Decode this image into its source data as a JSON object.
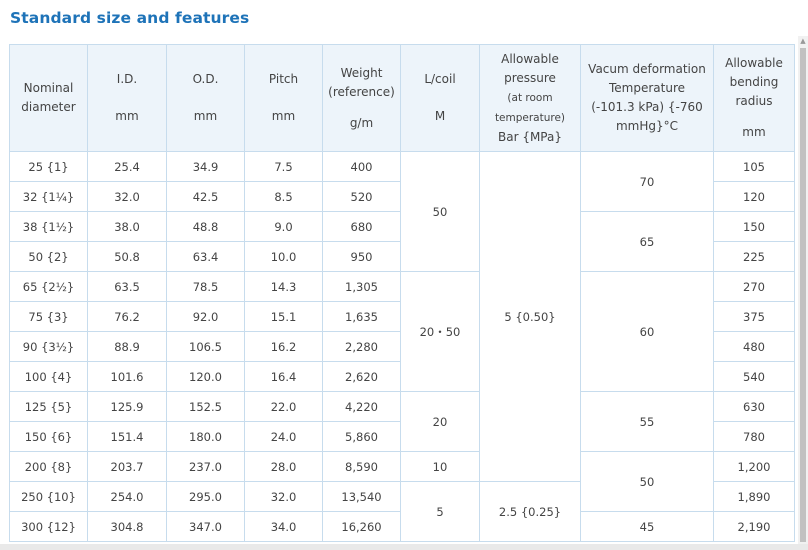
{
  "title": "Standard size and features",
  "headers": {
    "nominal": [
      "Nominal",
      "diameter"
    ],
    "id": {
      "label": "I.D.",
      "unit": "mm"
    },
    "od": {
      "label": "O.D.",
      "unit": "mm"
    },
    "pitch": {
      "label": "Pitch",
      "unit": "mm"
    },
    "weight": {
      "label1": "Weight",
      "label2": "(reference)",
      "unit": "g/m"
    },
    "coil": {
      "label": "L/coil",
      "unit": "M"
    },
    "pressure": {
      "l1": "Allowable",
      "l2": "pressure",
      "l3": "(at room",
      "l4": "temperature)",
      "l5": "Bar {MPa}"
    },
    "vacuum": {
      "l1": "Vacum deformation",
      "l2": "Temperature",
      "l3": "(-101.3 kPa) {-760",
      "l4": "mmHg}°C"
    },
    "bending": {
      "l1": "Allowable",
      "l2": "bending",
      "l3": "radius",
      "unit": "mm"
    }
  },
  "rows": [
    {
      "nominal": "25 {1}",
      "id": "25.4",
      "od": "34.9",
      "pitch": "7.5",
      "weight": "400",
      "radius": "105"
    },
    {
      "nominal": "32 {1¼}",
      "id": "32.0",
      "od": "42.5",
      "pitch": "8.5",
      "weight": "520",
      "radius": "120"
    },
    {
      "nominal": "38 {1½}",
      "id": "38.0",
      "od": "48.8",
      "pitch": "9.0",
      "weight": "680",
      "radius": "150"
    },
    {
      "nominal": "50 {2}",
      "id": "50.8",
      "od": "63.4",
      "pitch": "10.0",
      "weight": "950",
      "radius": "225"
    },
    {
      "nominal": "65 {2½}",
      "id": "63.5",
      "od": "78.5",
      "pitch": "14.3",
      "weight": "1,305",
      "radius": "270"
    },
    {
      "nominal": "75 {3}",
      "id": "76.2",
      "od": "92.0",
      "pitch": "15.1",
      "weight": "1,635",
      "radius": "375"
    },
    {
      "nominal": "90 {3½}",
      "id": "88.9",
      "od": "106.5",
      "pitch": "16.2",
      "weight": "2,280",
      "radius": "480"
    },
    {
      "nominal": "100 {4}",
      "id": "101.6",
      "od": "120.0",
      "pitch": "16.4",
      "weight": "2,620",
      "radius": "540"
    },
    {
      "nominal": "125 {5}",
      "id": "125.9",
      "od": "152.5",
      "pitch": "22.0",
      "weight": "4,220",
      "radius": "630"
    },
    {
      "nominal": "150 {6}",
      "id": "151.4",
      "od": "180.0",
      "pitch": "24.0",
      "weight": "5,860",
      "radius": "780"
    },
    {
      "nominal": "200 {8}",
      "id": "203.7",
      "od": "237.0",
      "pitch": "28.0",
      "weight": "8,590",
      "radius": "1,200"
    },
    {
      "nominal": "250 {10}",
      "id": "254.0",
      "od": "295.0",
      "pitch": "32.0",
      "weight": "13,540",
      "radius": "1,890"
    },
    {
      "nominal": "300 {12}",
      "id": "304.8",
      "od": "347.0",
      "pitch": "34.0",
      "weight": "16,260",
      "radius": "2,190"
    }
  ],
  "coil_groups": [
    "50",
    "20・50",
    "20",
    "10",
    "5"
  ],
  "pressure_groups": [
    "5 {0.50}",
    "2.5 {0.25}"
  ],
  "vacuum_groups": [
    "70",
    "65",
    "60",
    "55",
    "50",
    "45"
  ]
}
